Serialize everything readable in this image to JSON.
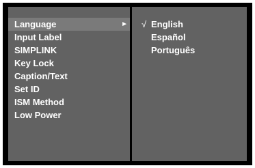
{
  "menu": {
    "items": [
      {
        "label": "Language",
        "selected": true
      },
      {
        "label": "Input Label",
        "selected": false
      },
      {
        "label": "SIMPLINK",
        "selected": false
      },
      {
        "label": "Key Lock",
        "selected": false
      },
      {
        "label": "Caption/Text",
        "selected": false
      },
      {
        "label": "Set ID",
        "selected": false
      },
      {
        "label": "ISM Method",
        "selected": false
      },
      {
        "label": "Low Power",
        "selected": false
      }
    ],
    "submenu_arrow": "►"
  },
  "language_options": {
    "check_mark": "√",
    "items": [
      {
        "label": "English",
        "checked": true
      },
      {
        "label": "Español",
        "checked": false
      },
      {
        "label": "Português",
        "checked": false
      }
    ]
  },
  "colors": {
    "frame": "#000000",
    "panel": "#626262",
    "highlight": "#7a7a7a",
    "text": "#ffffff"
  }
}
